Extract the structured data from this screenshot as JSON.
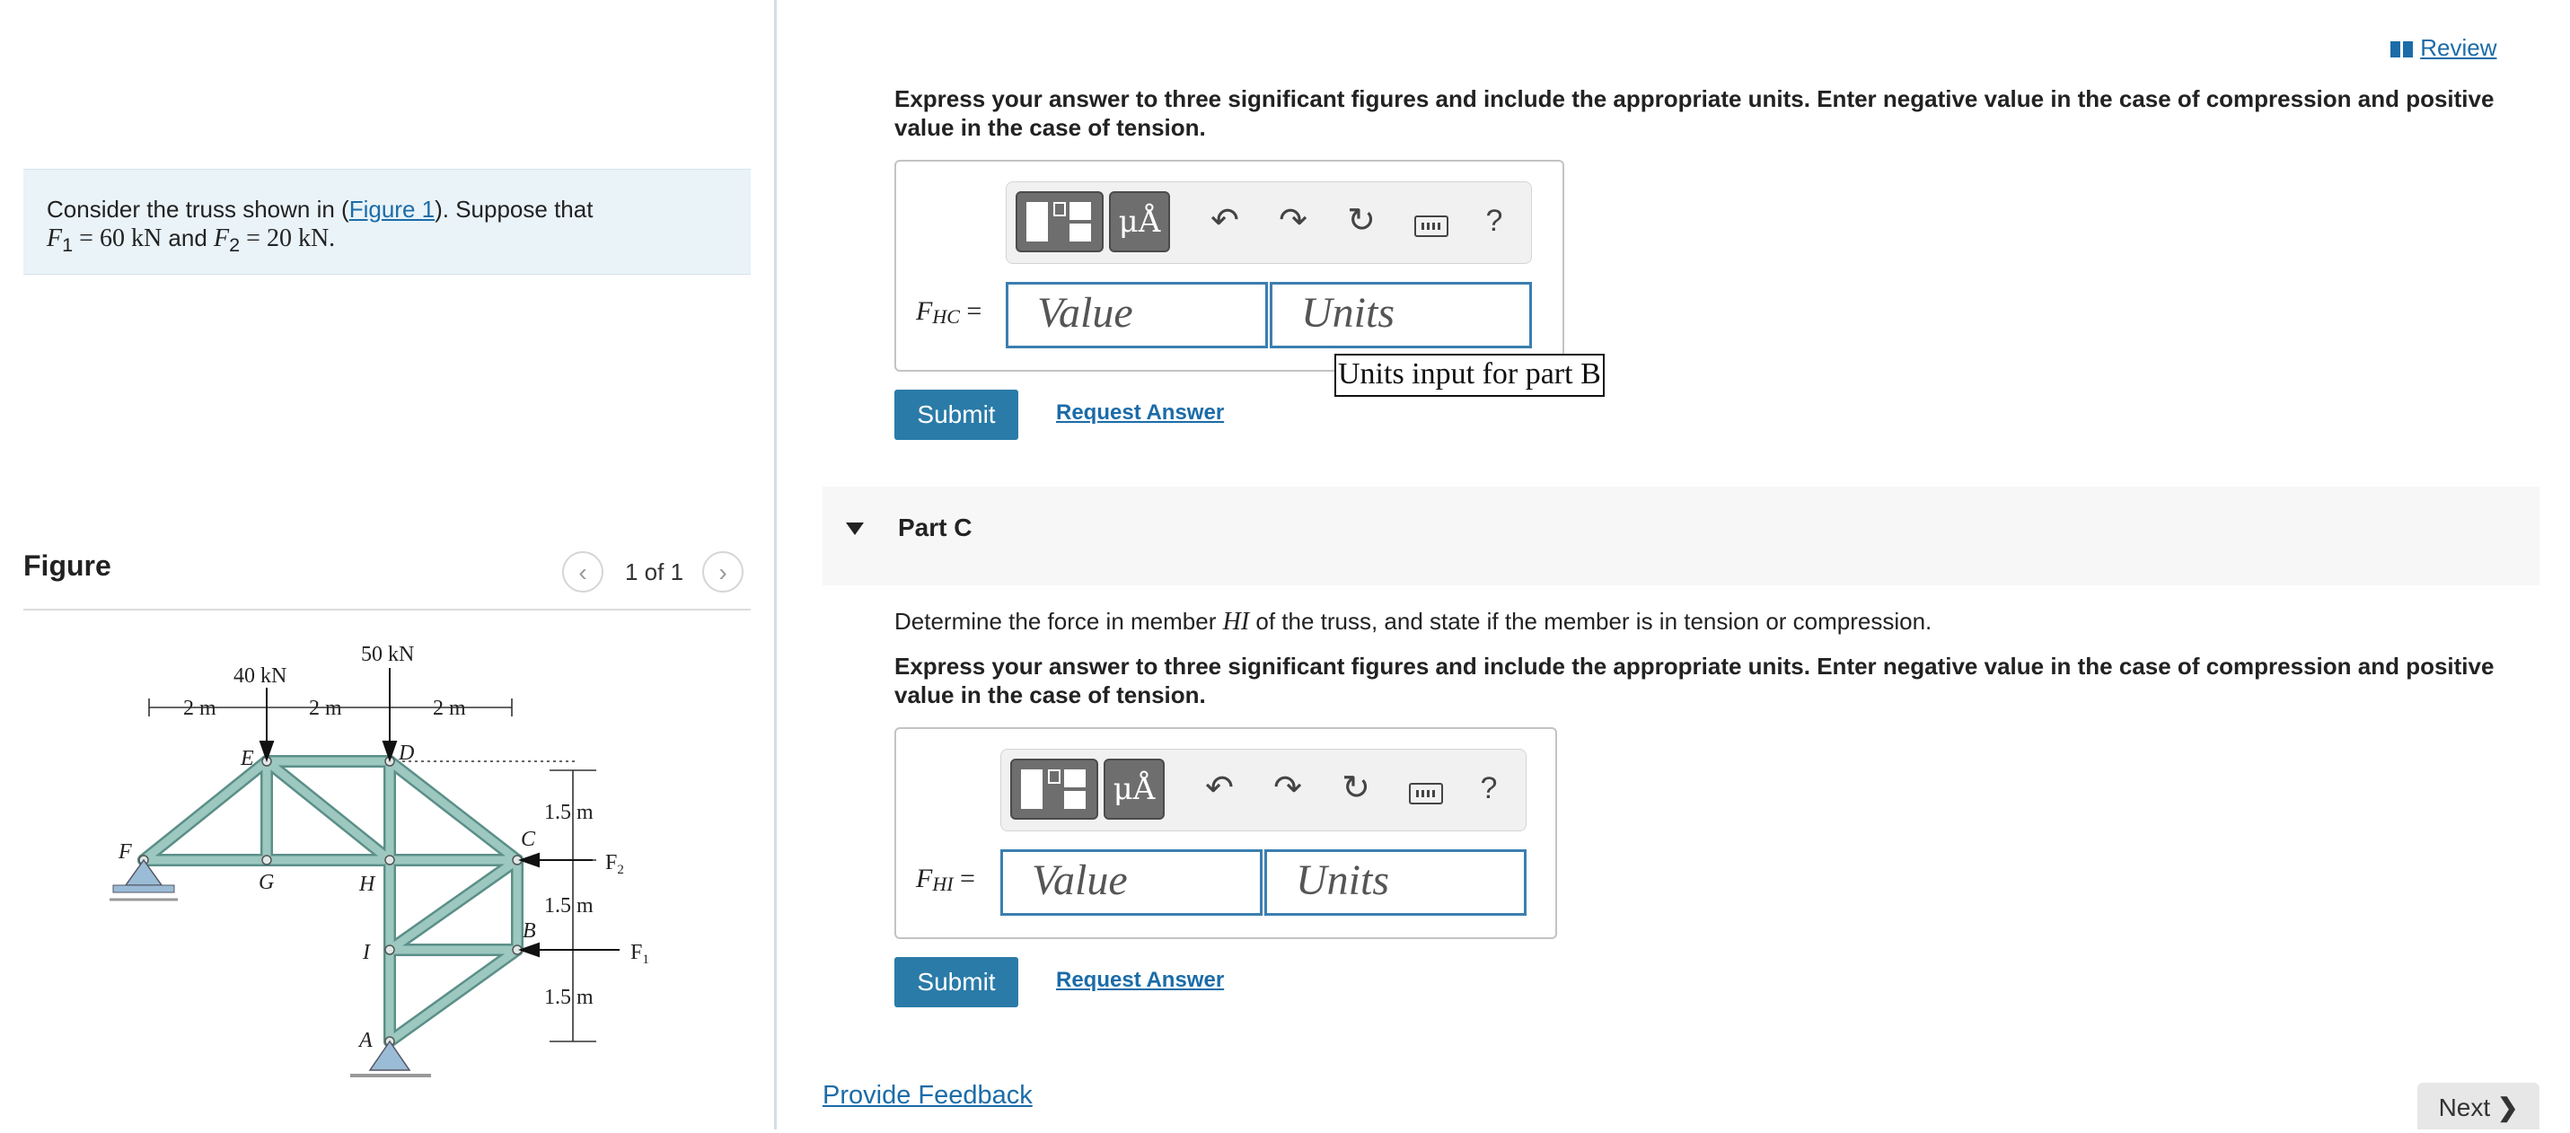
{
  "problem": {
    "intro_before_link": "Consider the truss shown in (",
    "figure_link": "Figure 1",
    "intro_after_link": "). Suppose that",
    "f1_symbol": "F",
    "f1_sub": "1",
    "f1_value": " = 60 kN",
    "and_text": " and ",
    "f2_symbol": "F",
    "f2_sub": "2",
    "f2_value": " = 20 kN."
  },
  "figure": {
    "title": "Figure",
    "pager": "1 of 1",
    "prev_glyph": "‹",
    "next_glyph": "›",
    "labels": {
      "load_40": "40 kN",
      "load_50": "50 kN",
      "dim_2m_a": "2 m",
      "dim_2m_b": "2 m",
      "dim_2m_c": "2 m",
      "dim_15_a": "1.5 m",
      "dim_15_b": "1.5 m",
      "dim_15_c": "1.5 m",
      "node_E": "E",
      "node_D": "D",
      "node_F": "F",
      "node_G": "G",
      "node_H": "H",
      "node_C": "C",
      "node_B": "B",
      "node_I": "I",
      "node_A": "A",
      "force_F2": "F",
      "force_F2_sub": "2",
      "force_F1": "F",
      "force_F1_sub": "1"
    }
  },
  "review": {
    "label": "Review"
  },
  "part_b": {
    "instructions": "Express your answer to three significant figures and include the appropriate units. Enter negative value in the case of compression and positive value in the case of tension.",
    "label_symbol": "F",
    "label_sub": "HC",
    "label_eq": " =",
    "value_placeholder": "Value",
    "units_placeholder": "Units",
    "tooltip": "Units input for part B",
    "submit": "Submit",
    "request": "Request Answer"
  },
  "part_c": {
    "title": "Part C",
    "prompt_before": "Determine the force in member ",
    "prompt_member": "HI",
    "prompt_after": " of the truss, and state if the member is in tension or compression.",
    "instructions": "Express your answer to three significant figures and include the appropriate units. Enter negative value in the case of compression and positive value in the case of tension.",
    "label_symbol": "F",
    "label_sub": "HI",
    "label_eq": " =",
    "value_placeholder": "Value",
    "units_placeholder": "Units",
    "submit": "Submit",
    "request": "Request Answer"
  },
  "toolbar": {
    "mu_label": "μÅ",
    "help_label": "?"
  },
  "footer": {
    "feedback": "Provide Feedback",
    "next": "Next"
  },
  "colors": {
    "link": "#1b6ca8",
    "submit": "#2a7ba8",
    "truss_member": "#9cc8c0",
    "problem_bg": "#e9f3f8"
  }
}
